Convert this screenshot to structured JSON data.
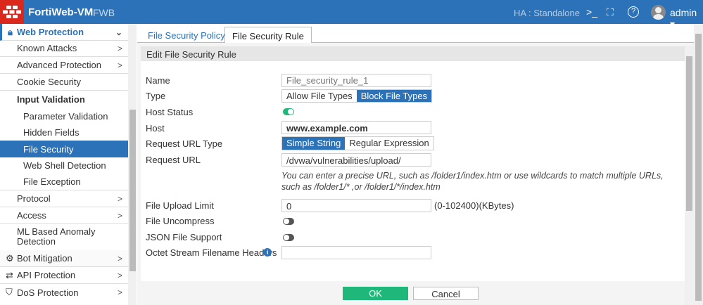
{
  "header": {
    "app": "FortiWeb-VM",
    "model": "FWB",
    "ha_label": "HA :",
    "ha_value": "Standalone",
    "user": "admin"
  },
  "sidebar": {
    "items": [
      {
        "label": "Web Protection",
        "chev": "⌄"
      },
      {
        "label": "Known Attacks",
        "chev": ">"
      },
      {
        "label": "Advanced Protection",
        "chev": ">"
      },
      {
        "label": "Cookie Security",
        "chev": ""
      },
      {
        "label": "Input Validation",
        "chev": ""
      },
      {
        "label": "Parameter Validation"
      },
      {
        "label": "Hidden Fields"
      },
      {
        "label": "File Security"
      },
      {
        "label": "Web Shell Detection"
      },
      {
        "label": "File Exception"
      },
      {
        "label": "Protocol",
        "chev": ">"
      },
      {
        "label": "Access",
        "chev": ">"
      },
      {
        "label": "ML Based Anomaly Detection",
        "chev": ""
      },
      {
        "label": "Bot Mitigation",
        "chev": ">"
      },
      {
        "label": "API Protection",
        "chev": ">"
      },
      {
        "label": "DoS Protection",
        "chev": ">"
      }
    ]
  },
  "tabs": [
    "File Security Policy",
    "File Security Rule"
  ],
  "section_title": "Edit File Security Rule",
  "form": {
    "name_label": "Name",
    "name_placeholder": "File_security_rule_1",
    "type_label": "Type",
    "type_options": [
      "Allow File Types",
      "Block File Types"
    ],
    "host_status_label": "Host Status",
    "host_status": true,
    "host_label": "Host",
    "host_value": "www.example.com",
    "url_type_label": "Request URL Type",
    "url_type_options": [
      "Simple String",
      "Regular Expression"
    ],
    "url_label": "Request URL",
    "url_value": "/dvwa/vulnerabilities/upload/",
    "url_hint": "You can enter a precise URL, such as /folder1/index.htm or use wildcards to match multiple URLs, such as /folder1/* ,or /folder1/*/index.htm",
    "upload_limit_label": "File Upload Limit",
    "upload_limit_value": "0",
    "upload_limit_range": "(0-102400)(KBytes)",
    "uncompress_label": "File Uncompress",
    "uncompress": false,
    "json_label": "JSON File Support",
    "json": false,
    "octet_label": "Octet Stream Filename Headers",
    "octet_value": ""
  },
  "buttons": {
    "ok": "OK",
    "cancel": "Cancel"
  }
}
